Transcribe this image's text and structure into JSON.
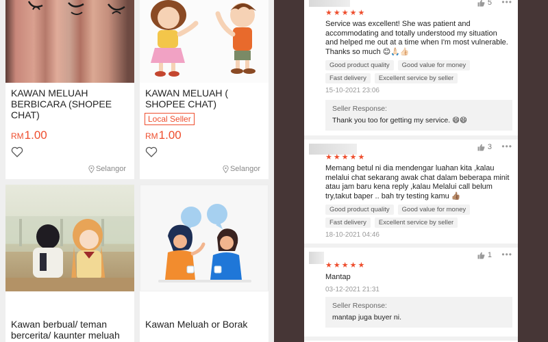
{
  "products": [
    {
      "title": "KAWAN MELUAH BERBICARA (SHOPEE CHAT)",
      "badge": "",
      "price_currency": "RM",
      "price_value": "1.00",
      "location": "Selangor"
    },
    {
      "title": "KAWAN MELUAH ( SHOPEE CHAT)",
      "badge": "Local Seller",
      "price_currency": "RM",
      "price_value": "1.00",
      "location": "Selangor"
    },
    {
      "title": "Kawan berbual/ teman bercerita/ kaunter meluah"
    },
    {
      "title": "Kawan Meluah or Borak"
    }
  ],
  "reviews": [
    {
      "stars": "★★★★★",
      "likes": "5",
      "text": "Service was excellent! She was patient and accommodating and totally understood my situation and helped me out at a time when I'm most vulnerable. Thanks so much 😊🙏🏻👍🏻",
      "tags": [
        "Good product quality",
        "Good value for money",
        "Fast delivery",
        "Excellent service by seller"
      ],
      "date": "15-10-2021 23:06",
      "response_label": "Seller Response:",
      "response_text": "Thank you too for getting my service. 😄😄"
    },
    {
      "stars": "★★★★★",
      "likes": "3",
      "text": "Memang betul ni dia mendengar luahan kita ,kalau melalui chat sekarang awak chat dalam beberapa minit atau jam baru kena reply ,kalau Melalui call belum try,takut baper .. bah try testing kamu 👍🏽",
      "tags": [
        "Good product quality",
        "Good value for money",
        "Fast delivery",
        "Excellent service by seller"
      ],
      "date": "18-10-2021 04:46"
    },
    {
      "stars": "★★★★★",
      "likes": "1",
      "text": "Mantap",
      "date": "03-12-2021 21:31",
      "response_label": "Seller Response:",
      "response_text": "mantap juga buyer ni."
    }
  ],
  "icons": {
    "heart": "heart-outline-icon",
    "location": "location-pin-icon",
    "like": "thumbs-up-icon",
    "more": "more-dots-icon"
  },
  "colors": {
    "accent": "#ee4d2d",
    "right_bg": "#463636",
    "left_bg": "#efefef"
  }
}
